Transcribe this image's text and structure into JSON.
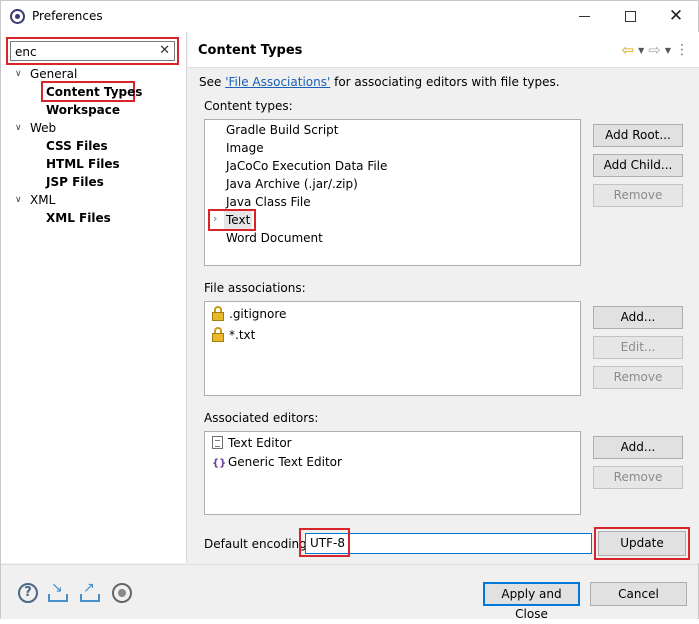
{
  "window": {
    "title": "Preferences"
  },
  "left": {
    "filter": {
      "value": "enc",
      "clear_icon": "clear-icon"
    },
    "tree": [
      {
        "label": "General",
        "bold": false,
        "expanded": true
      },
      {
        "label": "Content Types",
        "bold": true
      },
      {
        "label": "Workspace",
        "bold": true
      },
      {
        "label": "Web",
        "bold": false,
        "expanded": true
      },
      {
        "label": "CSS Files",
        "bold": true
      },
      {
        "label": "HTML Files",
        "bold": true
      },
      {
        "label": "JSP Files",
        "bold": true
      },
      {
        "label": "XML",
        "bold": false,
        "expanded": true
      },
      {
        "label": "XML Files",
        "bold": true
      }
    ]
  },
  "main": {
    "title": "Content Types",
    "see_prefix": "See ",
    "see_link": "'File Associations'",
    "see_suffix": " for associating editors with file types.",
    "content_types_label": "Content types:",
    "content_types": [
      "Gradle Build Script",
      "Image",
      "JaCoCo Execution Data File",
      "Java Archive (.jar/.zip)",
      "Java Class File",
      "Text",
      "Word Document"
    ],
    "content_buttons": {
      "add_root": "Add Root...",
      "add_child": "Add Child...",
      "remove": "Remove"
    },
    "file_assoc_label": "File associations:",
    "file_assocs": [
      ".gitignore",
      "*.txt"
    ],
    "file_buttons": {
      "add": "Add...",
      "edit": "Edit...",
      "remove": "Remove"
    },
    "editors_label": "Associated editors:",
    "editors": [
      "Text Editor",
      "Generic Text Editor"
    ],
    "editor_buttons": {
      "add": "Add...",
      "remove": "Remove"
    },
    "encoding_label": "Default encoding:",
    "encoding_value": "UTF-8",
    "update_button": "Update"
  },
  "bottom": {
    "apply_close": "Apply and Close",
    "cancel": "Cancel"
  },
  "colors": {
    "highlight": "#d8252c",
    "accent": "#0078d7",
    "link": "#1a5fb4"
  }
}
